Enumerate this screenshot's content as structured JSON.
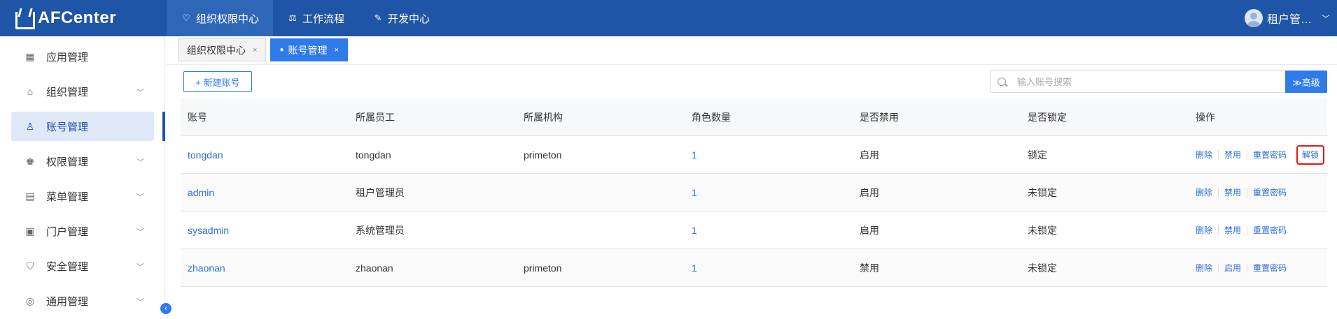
{
  "app": {
    "title": "AFCenter"
  },
  "nav": [
    {
      "label": "组织权限中心",
      "icon": "heart-shield-icon",
      "active": true
    },
    {
      "label": "工作流程",
      "icon": "scale-icon",
      "active": false
    },
    {
      "label": "开发中心",
      "icon": "edit-icon",
      "active": false
    }
  ],
  "user": {
    "name": "租户管…"
  },
  "sidebar": {
    "items": [
      {
        "label": "应用管理",
        "icon": "grid-icon"
      },
      {
        "label": "组织管理",
        "icon": "gamepad-icon"
      },
      {
        "label": "账号管理",
        "icon": "user-icon",
        "active": true
      },
      {
        "label": "权限管理",
        "icon": "stamp-icon"
      },
      {
        "label": "菜单管理",
        "icon": "menu-doc-icon"
      },
      {
        "label": "门户管理",
        "icon": "portal-icon"
      },
      {
        "label": "安全管理",
        "icon": "shield-icon"
      },
      {
        "label": "通用管理",
        "icon": "settings-icon"
      }
    ]
  },
  "tabs": [
    {
      "label": "组织权限中心",
      "active": false
    },
    {
      "label": "账号管理",
      "active": true
    }
  ],
  "toolbar": {
    "new_label": "+ 新建账号",
    "search_placeholder": "输入账号搜索",
    "advanced_label": "≫高级"
  },
  "table": {
    "headers": [
      "账号",
      "所属员工",
      "所属机构",
      "角色数量",
      "是否禁用",
      "是否锁定",
      "操作"
    ],
    "rows": [
      {
        "account": "tongdan",
        "employee": "tongdan",
        "org": "primeton",
        "roles": "1",
        "disabled": "启用",
        "locked": "锁定",
        "ops": [
          "删除",
          "禁用",
          "重置密码",
          "解锁"
        ]
      },
      {
        "account": "admin",
        "employee": "租户管理员",
        "org": "",
        "roles": "1",
        "disabled": "启用",
        "locked": "未锁定",
        "ops": [
          "删除",
          "禁用",
          "重置密码"
        ]
      },
      {
        "account": "sysadmin",
        "employee": "系统管理员",
        "org": "",
        "roles": "1",
        "disabled": "启用",
        "locked": "未锁定",
        "ops": [
          "删除",
          "禁用",
          "重置密码"
        ]
      },
      {
        "account": "zhaonan",
        "employee": "zhaonan",
        "org": "primeton",
        "roles": "1",
        "disabled": "禁用",
        "locked": "未锁定",
        "ops": [
          "删除",
          "启用",
          "重置密码"
        ]
      }
    ]
  }
}
